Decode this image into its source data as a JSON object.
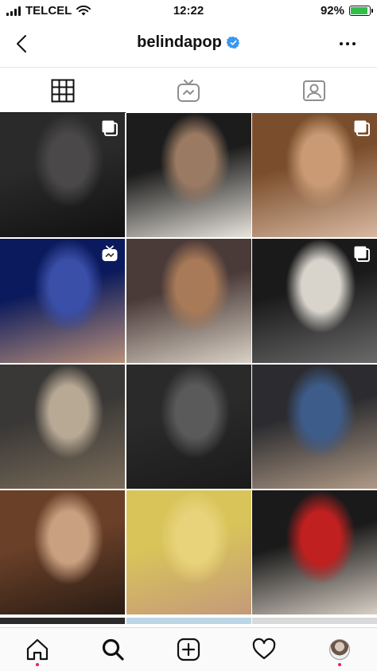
{
  "status_bar": {
    "carrier": "TELCEL",
    "time": "12:22",
    "battery_percent": "92%",
    "battery_level": 0.92,
    "icons": [
      "signal-icon",
      "wifi-icon",
      "battery-icon"
    ]
  },
  "header": {
    "username": "belindapop",
    "verified": true,
    "icons": [
      "back-chevron-icon",
      "verified-badge-icon",
      "more-options-icon"
    ]
  },
  "tabs": [
    {
      "name": "grid",
      "icon": "grid-icon",
      "active": true
    },
    {
      "name": "igtv",
      "icon": "igtv-icon",
      "active": false
    },
    {
      "name": "tagged",
      "icon": "tagged-user-icon",
      "active": false
    }
  ],
  "posts": [
    {
      "type": "carousel",
      "badge": "multiple-posts-icon",
      "colors": [
        "#2a2a2a",
        "#4a4848",
        "#111111"
      ]
    },
    {
      "type": "photo",
      "badge": null,
      "colors": [
        "#1c1c1c",
        "#9a7a62",
        "#e8e4dd"
      ]
    },
    {
      "type": "carousel",
      "badge": "multiple-posts-icon",
      "colors": [
        "#7a4e2c",
        "#c99a74",
        "#d8b8a0"
      ]
    },
    {
      "type": "igtv",
      "badge": "igtv-icon",
      "colors": [
        "#0b1a5c",
        "#3a4fa8",
        "#b8907a"
      ]
    },
    {
      "type": "photo",
      "badge": null,
      "colors": [
        "#4a3a38",
        "#a87a58",
        "#d9d1c5"
      ]
    },
    {
      "type": "carousel",
      "badge": "multiple-posts-icon",
      "colors": [
        "#1a1a1a",
        "#d8d4cc",
        "#6a6a6a"
      ]
    },
    {
      "type": "photo",
      "badge": null,
      "colors": [
        "#3a3836",
        "#b8a994",
        "#7a6c5a"
      ]
    },
    {
      "type": "photo",
      "badge": null,
      "colors": [
        "#2a2a2a",
        "#5a5a5a",
        "#1a1a1a"
      ]
    },
    {
      "type": "photo",
      "badge": null,
      "colors": [
        "#2c2c30",
        "#3e5c8a",
        "#b09a86"
      ]
    },
    {
      "type": "photo",
      "badge": null,
      "colors": [
        "#6a4028",
        "#c9a080",
        "#2a1c14"
      ]
    },
    {
      "type": "photo",
      "badge": null,
      "colors": [
        "#d9c45a",
        "#e8d27a",
        "#c49a7a"
      ]
    },
    {
      "type": "photo",
      "badge": null,
      "colors": [
        "#1a1a1a",
        "#c02020",
        "#d8cfc4"
      ]
    }
  ],
  "partial_row_colors": [
    "#2a2a2a",
    "#bcd6e6",
    "#d9d9d9"
  ],
  "bottom_nav": [
    {
      "name": "home",
      "icon": "home-icon",
      "notification_dot": true
    },
    {
      "name": "search",
      "icon": "search-icon",
      "active": true
    },
    {
      "name": "new-post",
      "icon": "new-post-icon"
    },
    {
      "name": "activity",
      "icon": "heart-icon"
    },
    {
      "name": "profile",
      "icon": "profile-avatar-icon",
      "notification_dot": true
    }
  ],
  "colors": {
    "notification_dot": "#e0245e",
    "verified_badge": "#3897f0",
    "battery_fill": "#2fbe4a"
  }
}
